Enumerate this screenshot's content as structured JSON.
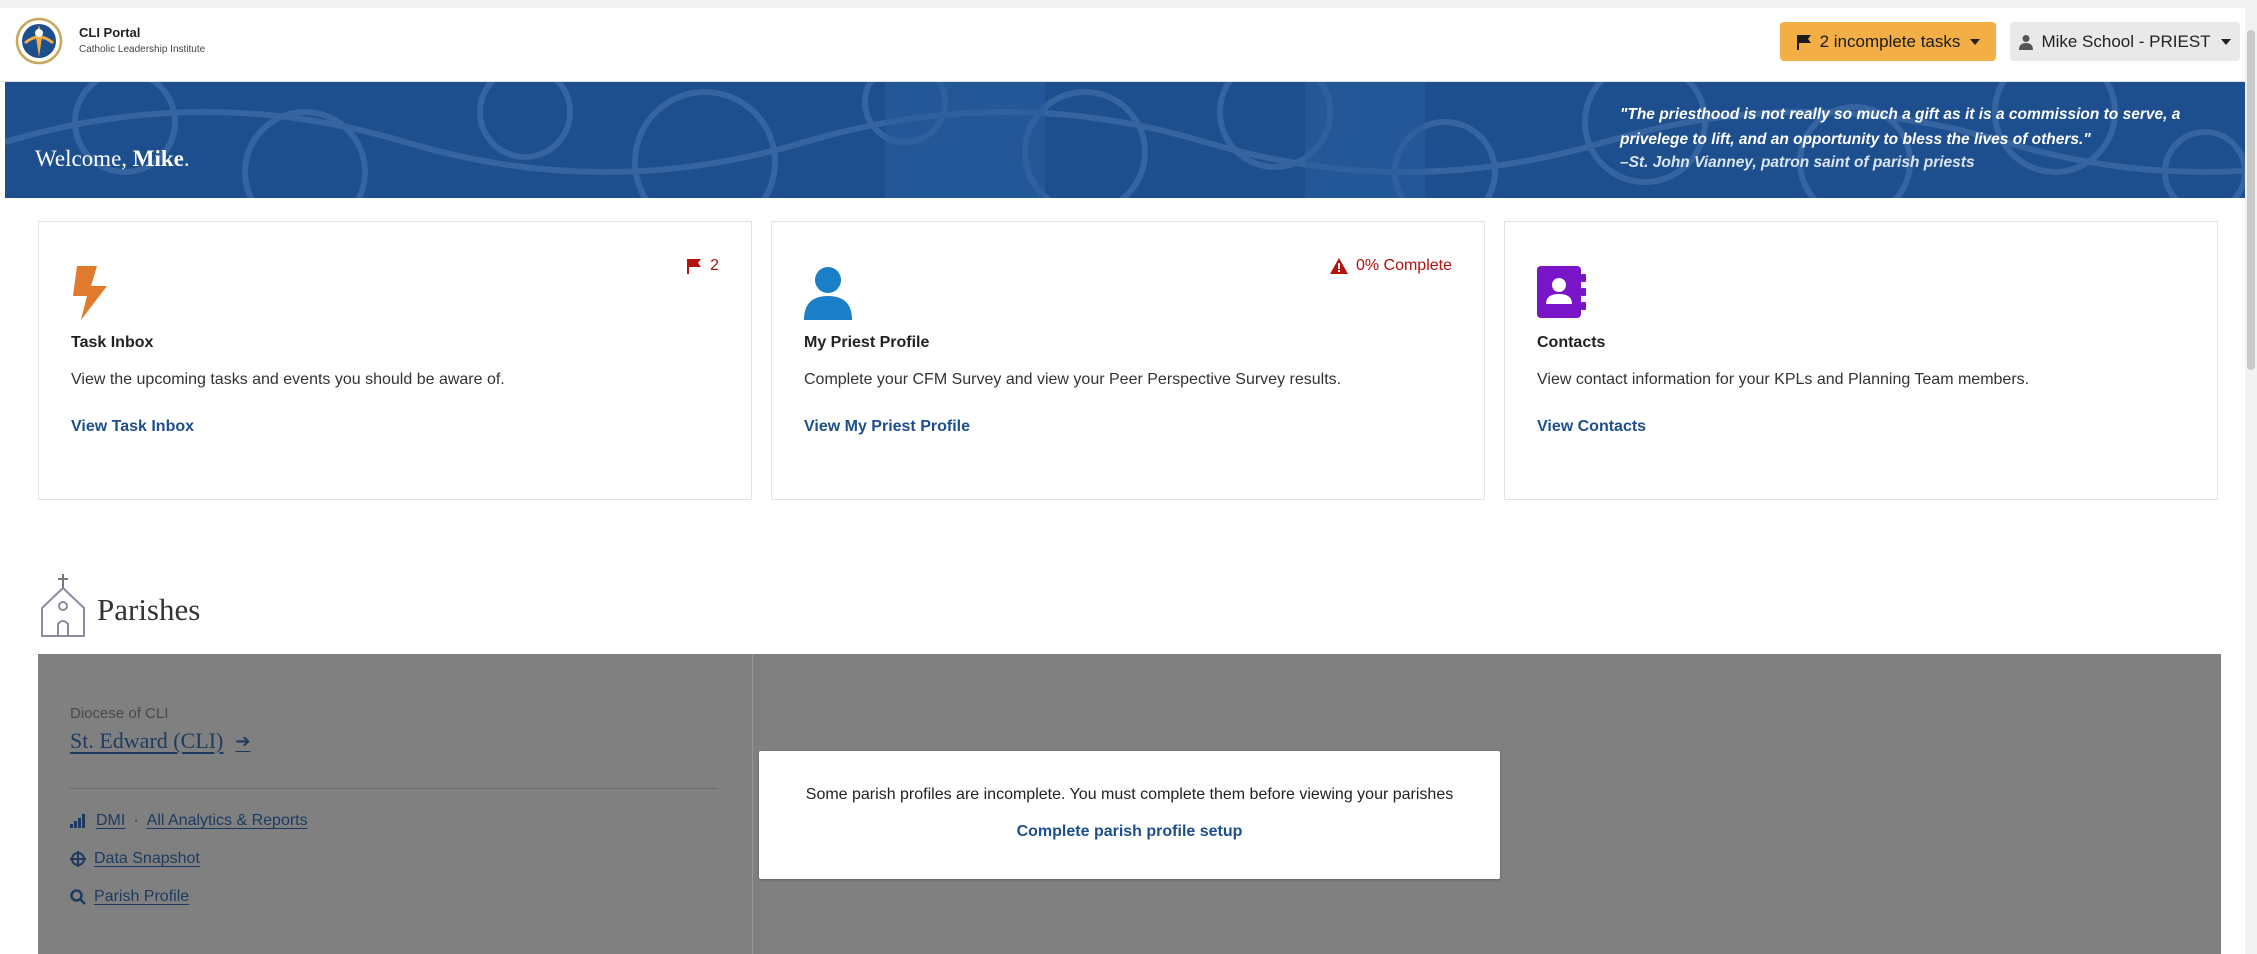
{
  "header": {
    "brand_name": "CLI Portal",
    "brand_subtitle": "Catholic Leadership Institute",
    "tasks_button": "2 incomplete tasks",
    "user_button": "Mike School - PRIEST"
  },
  "banner": {
    "welcome_prefix": "Welcome,",
    "welcome_name": "Mike",
    "welcome_suffix": ".",
    "quote": "\"The priesthood is not really so much a gift as it is a commission to serve, a privelege to lift, and an opportunity to bless the lives of others.\"",
    "attribution": "–St. John Vianney, patron saint of parish priests"
  },
  "cards": [
    {
      "title": "Task Inbox",
      "description": "View the upcoming tasks and events you should be aware of.",
      "link": "View Task Inbox",
      "badge": "2",
      "icon": "lightning-icon",
      "icon_color": "#e07a2c"
    },
    {
      "title": "My Priest Profile",
      "description": "Complete your CFM Survey and view your Peer Perspective Survey results.",
      "link": "View My Priest Profile",
      "badge": "0% Complete",
      "icon": "person-icon",
      "icon_color": "#1a7fc6"
    },
    {
      "title": "Contacts",
      "description": "View contact information for your KPLs and Planning Team members.",
      "link": "View Contacts",
      "icon": "address-book-icon",
      "icon_color": "#7a14c8"
    }
  ],
  "parishes": {
    "heading": "Parishes",
    "diocese": "Diocese of CLI",
    "parish_name": "St. Edward (CLI)",
    "links": {
      "dmi": "DMI",
      "separator": "·",
      "analytics": "All Analytics & Reports",
      "snapshot": "Data Snapshot",
      "profile": "Parish Profile"
    },
    "modal": {
      "message": "Some parish profiles are incomplete. You must complete them before viewing your parishes",
      "action": "Complete parish profile setup"
    }
  },
  "colors": {
    "banner": "#1d4f8e",
    "accent": "#f3ae46",
    "alert": "#b3120e",
    "link": "#1d4f8e",
    "overlay": "#808080"
  }
}
